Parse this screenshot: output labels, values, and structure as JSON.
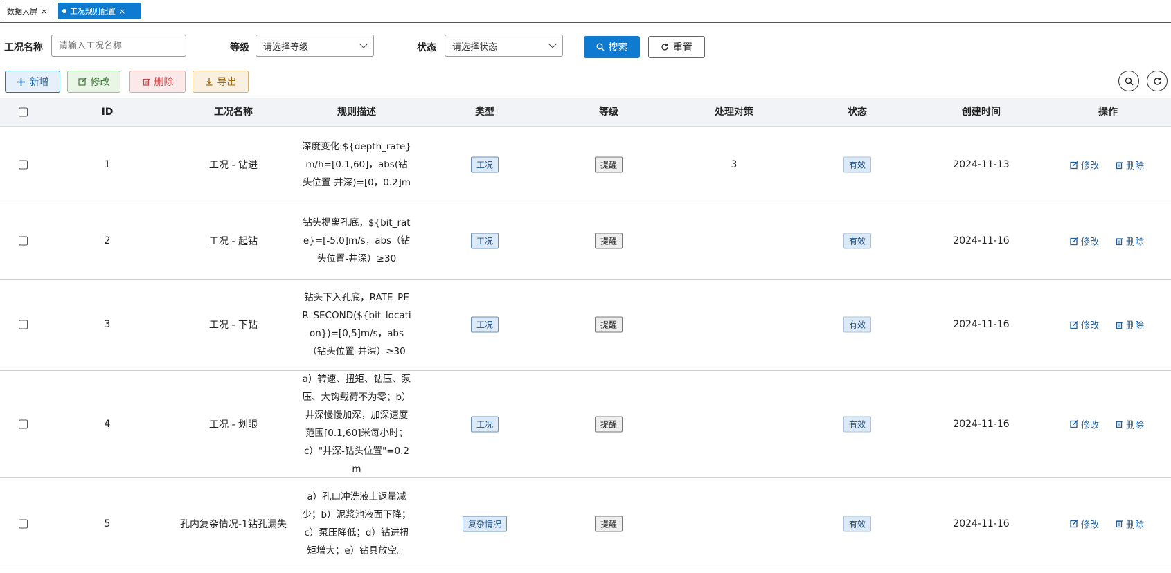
{
  "tabs": [
    {
      "label": "数据大屏",
      "close": "×",
      "active": false
    },
    {
      "label": "工况规则配置",
      "close": "×",
      "active": true
    }
  ],
  "search": {
    "name_label": "工况名称",
    "name_placeholder": "请输入工况名称",
    "level_label": "等级",
    "level_placeholder": "请选择等级",
    "status_label": "状态",
    "status_placeholder": "请选择状态",
    "search_button": "搜索",
    "reset_button": "重置"
  },
  "toolbar": {
    "add": "新增",
    "edit": "修改",
    "delete": "删除",
    "export": "导出"
  },
  "table": {
    "headers": [
      "ID",
      "工况名称",
      "规则描述",
      "类型",
      "等级",
      "处理对策",
      "状态",
      "创建时间",
      "操作"
    ],
    "rows": [
      {
        "id": "1",
        "name": "工况 - 钻进",
        "desc": "深度变化:${depth_rate}m/h=[0.1,60]，abs(钻头位置-井深)=[0，0.2]m",
        "type": "工况",
        "level": "提醒",
        "measure": "3",
        "status": "有效",
        "created": "2024-11-13",
        "edit": "修改",
        "delete": "删除"
      },
      {
        "id": "2",
        "name": "工况 - 起钻",
        "desc": "钻头提离孔底，${bit_rate}=[-5,0]m/s，abs（钻头位置-井深）≥30",
        "type": "工况",
        "level": "提醒",
        "measure": "",
        "status": "有效",
        "created": "2024-11-16",
        "edit": "修改",
        "delete": "删除"
      },
      {
        "id": "3",
        "name": "工况 - 下钻",
        "desc": "钻头下入孔底，RATE_PER_SECOND(${bit_location})=[0,5]m/s，abs（钻头位置-井深）≥30",
        "type": "工况",
        "level": "提醒",
        "measure": "",
        "status": "有效",
        "created": "2024-11-16",
        "edit": "修改",
        "delete": "删除"
      },
      {
        "id": "4",
        "name": "工况 - 划眼",
        "desc": "a）转速、扭矩、钻压、泵压、大钩载荷不为零；b）井深慢慢加深，加深速度范围[0.1,60]米每小时；c）\"井深-钻头位置\"=0.2m",
        "type": "工况",
        "level": "提醒",
        "measure": "",
        "status": "有效",
        "created": "2024-11-16",
        "edit": "修改",
        "delete": "删除"
      },
      {
        "id": "5",
        "name": "孔内复杂情况-1钻孔漏失",
        "desc": "a）孔口冲洗液上返量减少；b）泥浆池液面下降；c）泵压降低；d）钻进扭矩增大；e）钻具放空。",
        "type": "复杂情况",
        "level": "提醒",
        "measure": "",
        "status": "有效",
        "created": "2024-11-16",
        "edit": "修改",
        "delete": "删除"
      }
    ]
  }
}
